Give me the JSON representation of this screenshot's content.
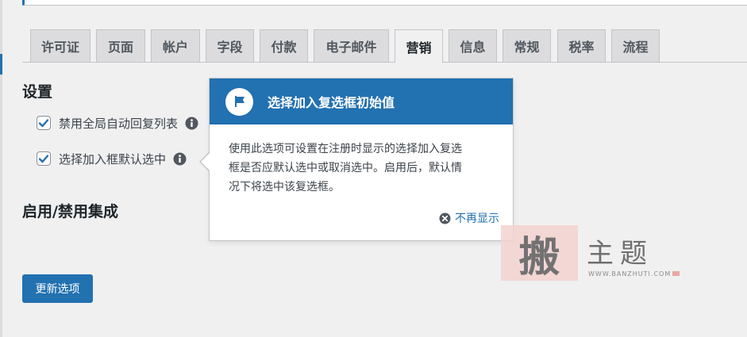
{
  "tabs": [
    {
      "label": "许可证"
    },
    {
      "label": "页面"
    },
    {
      "label": "帐户"
    },
    {
      "label": "字段"
    },
    {
      "label": "付款"
    },
    {
      "label": "电子邮件"
    },
    {
      "label": "营销",
      "active": true
    },
    {
      "label": "信息"
    },
    {
      "label": "常规"
    },
    {
      "label": "税率"
    },
    {
      "label": "流程"
    }
  ],
  "settings": {
    "title": "设置",
    "options": [
      {
        "label": "禁用全局自动回复列表",
        "checked": true
      },
      {
        "label": "选择加入框默认选中",
        "checked": true
      }
    ]
  },
  "integration": {
    "title": "启用/禁用集成"
  },
  "update_button": "更新选项",
  "pointer": {
    "title": "选择加入复选框初始值",
    "body_lines": [
      "使用此选项可设置在注册时显示的选择加入复选",
      "框是否应默认选中或取消选中。启用后，默认情",
      "况下将选中该复选框。"
    ],
    "dismiss": "不再显示"
  },
  "watermark": {
    "big": "搬",
    "sub": "主题",
    "url": "WWW.BANZHUTI.COM"
  },
  "colors": {
    "accent": "#2271b1",
    "background": "#f0f0f1",
    "tab_bg": "#dcdcde"
  }
}
